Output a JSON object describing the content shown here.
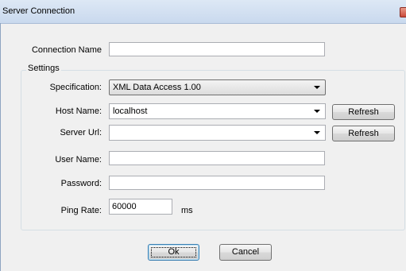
{
  "window": {
    "title": "Server Connection"
  },
  "connection": {
    "label": "Connection Name",
    "value": ""
  },
  "settings": {
    "legend": "Settings",
    "specification": {
      "label": "Specification:",
      "value": "XML Data Access 1.00"
    },
    "host": {
      "label": "Host Name:",
      "value": "localhost",
      "refresh_label": "Refresh"
    },
    "server_url": {
      "label": "Server Url:",
      "value": "",
      "refresh_label": "Refresh"
    },
    "user_name": {
      "label": "User Name:",
      "value": ""
    },
    "password": {
      "label": "Password:",
      "value": ""
    },
    "ping_rate": {
      "label": "Ping Rate:",
      "value": "60000",
      "unit": "ms"
    }
  },
  "buttons": {
    "ok_label": "Ok",
    "cancel_label": "Cancel"
  },
  "icons": {
    "close": "close-icon",
    "dropdown": "chevron-down-icon"
  }
}
